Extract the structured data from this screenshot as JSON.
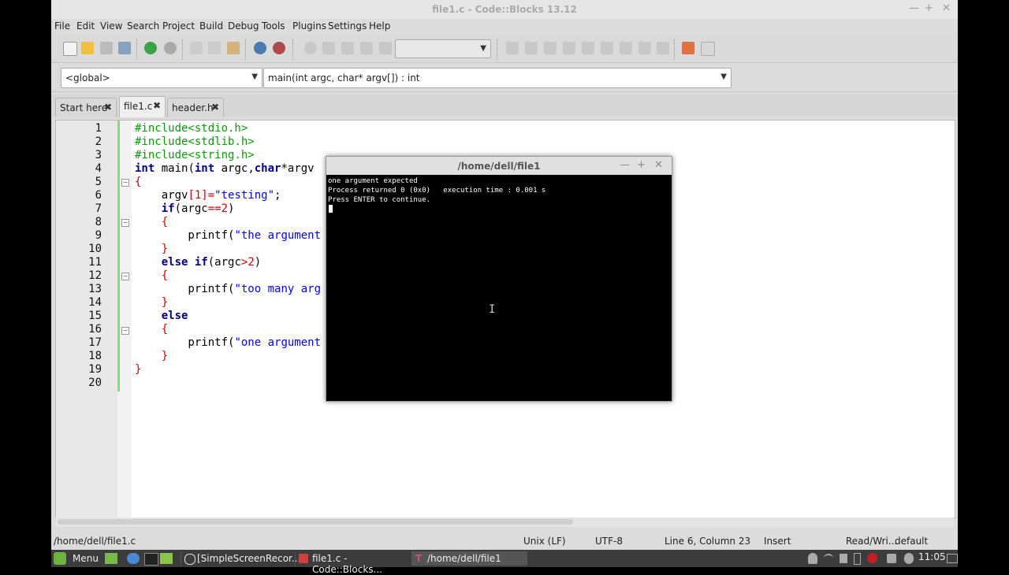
{
  "window": {
    "title": "file1.c - Code::Blocks 13.12",
    "min": "—",
    "max": "+",
    "close": "✕"
  },
  "menu": [
    "File",
    "Edit",
    "View",
    "Search",
    "Project",
    "Build",
    "Debug",
    "Tools",
    "Plugins",
    "Settings",
    "Help"
  ],
  "codebar": {
    "scope": "<global>",
    "function": "main(int argc, char* argv[]) : int"
  },
  "tabs": [
    {
      "label": "Start here",
      "close": "✖"
    },
    {
      "label": "file1.c",
      "close": "✖"
    },
    {
      "label": "header.h",
      "close": "✖"
    }
  ],
  "line_numbers": [
    "1",
    "2",
    "3",
    "4",
    "5",
    "6",
    "7",
    "8",
    "9",
    "10",
    "11",
    "12",
    "13",
    "14",
    "15",
    "16",
    "17",
    "18",
    "19",
    "20"
  ],
  "code": {
    "l1": "#include<stdio.h>",
    "l2": "#include<stdlib.h>",
    "l3": "#include<string.h>",
    "l4a": "int",
    "l4b": " main(",
    "l4c": "int",
    "l4d": " argc,",
    "l4e": "char",
    "l4f": "*argv",
    "l5": "{",
    "l6a": "    argv",
    "l6b": "[1]",
    "l6c": "=",
    "l6d": "\"testing\"",
    "l6e": ";",
    "l7a": "    ",
    "l7b": "if",
    "l7c": "(argc",
    "l7d": "==2",
    "l7e": ")",
    "l8": "    {",
    "l9a": "        printf(",
    "l9b": "\"the argument",
    "l10": "    }",
    "l11a": "    ",
    "l11b": "else if",
    "l11c": "(argc",
    "l11d": ">2",
    "l11e": ")",
    "l12": "    {",
    "l13a": "        printf(",
    "l13b": "\"too many arg",
    "l14": "    }",
    "l15a": "    ",
    "l15b": "else",
    "l16": "    {",
    "l17a": "        printf(",
    "l17b": "\"one argument",
    "l18": "    }",
    "l19": "}"
  },
  "terminal": {
    "title": "/home/dell/file1",
    "min": "—",
    "max": "+",
    "close": "✕",
    "output": "one argument expected\nProcess returned 0 (0x0)   execution time : 0.001 s\nPress ENTER to continue."
  },
  "status": {
    "path": "/home/dell/file1.c",
    "eol": "Unix (LF)",
    "encoding": "UTF-8",
    "position": "Line 6, Column 23",
    "mode": "Insert",
    "access": "Read/Wri...",
    "profile": "default"
  },
  "taskbar": {
    "menu": "Menu",
    "tasks": [
      "[SimpleScreenRecor...",
      "file1.c - Code::Blocks...",
      "/home/dell/file1"
    ],
    "clock": "11:05"
  },
  "colors": {
    "preprocessor": "#0a9b0a",
    "keyword": "#000080",
    "string": "#0000ff",
    "operator": "#cc0000"
  }
}
